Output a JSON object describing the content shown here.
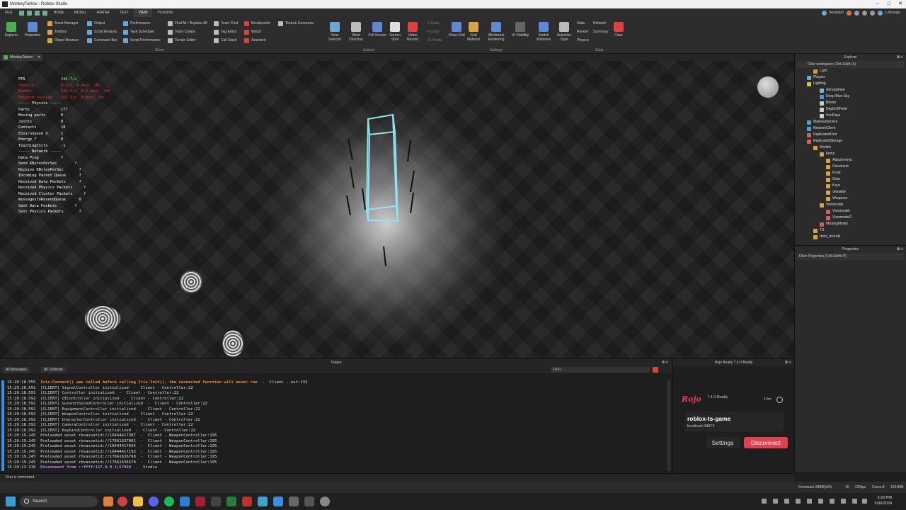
{
  "window": {
    "title": "MonkeyTarkov - Roblox Studio"
  },
  "menu": {
    "tabs": [
      "FILE",
      "HOME",
      "MODEL",
      "AVATAR",
      "TEST",
      "VIEW",
      "PLUGINS"
    ],
    "active": "VIEW",
    "assistant": "Assistant",
    "user": "LeBoogle"
  },
  "ribbon": {
    "show": {
      "label": "Show",
      "big": [
        "Explorer",
        "Properties"
      ],
      "col1": [
        "Asset Manager",
        "Toolbox",
        "Object Browser"
      ],
      "col2": [
        "Output",
        "Script Analysis",
        "Command Bar"
      ],
      "col3": [
        "Performance",
        "Task Scheduler",
        "Script Performance"
      ],
      "col4": [
        "Find All / Replace All",
        "Team Create",
        "Terrain Editor"
      ],
      "col5": [
        "Team Chat",
        "Tag Editor",
        "Call Stack"
      ],
      "col6": [
        "Breakpoints",
        "Watch",
        "Assistant"
      ],
      "col7": [
        "Texture Generator"
      ]
    },
    "actions": {
      "label": "Actions",
      "buttons": [
        "View Selector",
        "Wind Direction",
        "Full Screen",
        "Screen Shot",
        "Video Record"
      ]
    },
    "settings": {
      "label": "Settings",
      "studs": [
        "2 Studs",
        "4 Studs",
        "16 Studs"
      ],
      "buttons": [
        "Show Grid",
        "Grid Material",
        "Wireframe Rendering",
        "UI Visibility",
        "Switch Windows",
        "Selection Style"
      ]
    },
    "stats": {
      "label": "Stats",
      "col1": [
        "Stats",
        "Render",
        "Physics"
      ],
      "col2": [
        "Network",
        "Summary"
      ],
      "clear": "Clear"
    }
  },
  "document_tab": "MonkeyTarkov",
  "viewport_stats": [
    {
      "k": "FPS",
      "v": "246.7/s",
      "c": "grn"
    },
    {
      "k": "Physics",
      "v": "0.0/s  0 msec  0%",
      "c": "red"
    },
    {
      "k": "Render",
      "v": "243.3/s  0.5 msec  12%",
      "c": "red"
    },
    {
      "k": "Network receive",
      "v": "163.1/s  0 msec  0%",
      "c": "red"
    },
    {
      "k": "----- Physics -----",
      "v": "",
      "c": ""
    },
    {
      "k": "Parts",
      "v": "177",
      "c": ""
    },
    {
      "k": "Moving parts",
      "v": "0",
      "c": ""
    },
    {
      "k": "Joints",
      "v": "0",
      "c": ""
    },
    {
      "k": "Contacts",
      "v": "10",
      "c": ""
    },
    {
      "k": "EnviroSpeed X",
      "v": "1",
      "c": ""
    },
    {
      "k": "Energy T",
      "v": "0",
      "c": ""
    },
    {
      "k": "TouchingCtcts",
      "v": "-1",
      "c": ""
    },
    {
      "k": "----- Network -----",
      "v": "",
      "c": ""
    },
    {
      "k": "Data Ping",
      "v": "?",
      "c": ""
    },
    {
      "k": "Send KBytesPerSec",
      "v": "      ?",
      "c": ""
    },
    {
      "k": "Receive KBytesPerSec",
      "v": "        ?",
      "c": ""
    },
    {
      "k": "Incoming Packet Queue",
      "v": "        ?",
      "c": ""
    },
    {
      "k": "Received Data Packets",
      "v": "        ?",
      "c": ""
    },
    {
      "k": "Received Physics Packets",
      "v": "          ?",
      "c": ""
    },
    {
      "k": "Received Cluster Packets",
      "v": "          ?",
      "c": ""
    },
    {
      "k": "messagesInResendQueue",
      "v": "        0",
      "c": ""
    },
    {
      "k": "Sent Data Packets",
      "v": "      ?",
      "c": ""
    },
    {
      "k": "Sent Physics Packets",
      "v": "        ?",
      "c": ""
    }
  ],
  "explorer": {
    "title": "Explorer",
    "filter": "Filter workspace (Ctrl+Shift+X)",
    "items": [
      {
        "label": "Light",
        "indent": 2,
        "color": "#c9a227"
      },
      {
        "label": "Players",
        "indent": 1,
        "color": "#6aa6d6"
      },
      {
        "label": "Lighting",
        "indent": 1,
        "color": "#e0c030"
      },
      {
        "label": "Atmosphere",
        "indent": 3,
        "color": "#7ab3e0"
      },
      {
        "label": "Deep Blue Sky",
        "indent": 3,
        "color": "#5c8ad8"
      },
      {
        "label": "Bloom",
        "indent": 3,
        "color": "#cccccc"
      },
      {
        "label": "DepthOfField",
        "indent": 3,
        "color": "#cccccc"
      },
      {
        "label": "SunRays",
        "indent": 3,
        "color": "#cccccc"
      },
      {
        "label": "MaterialService",
        "indent": 1,
        "color": "#4da3c9"
      },
      {
        "label": "NetworkClient",
        "indent": 1,
        "color": "#4da3c9"
      },
      {
        "label": "ReplicatedFirst",
        "indent": 1,
        "color": "#d06060"
      },
      {
        "label": "ReplicatedStorage",
        "indent": 1,
        "color": "#d06060"
      },
      {
        "label": "Models",
        "indent": 2,
        "color": "#d8a441"
      },
      {
        "label": "Items",
        "indent": 3,
        "color": "#d8a441"
      },
      {
        "label": "Attachments",
        "indent": 4,
        "color": "#d8a441"
      },
      {
        "label": "Document",
        "indent": 4,
        "color": "#d8a441"
      },
      {
        "label": "Food",
        "indent": 4,
        "color": "#d8a441"
      },
      {
        "label": "Gear",
        "indent": 4,
        "color": "#d8a441"
      },
      {
        "label": "Keys",
        "indent": 4,
        "color": "#d8a441"
      },
      {
        "label": "Valuable",
        "indent": 4,
        "color": "#d8a441"
      },
      {
        "label": "Weapons",
        "indent": 4,
        "color": "#d8a441"
      },
      {
        "label": "Viewmodel",
        "indent": 3,
        "color": "#d8a441"
      },
      {
        "label": "Viewmodel",
        "indent": 4,
        "color": "#d06060"
      },
      {
        "label": "Viewmodel2",
        "indent": 4,
        "color": "#d06060"
      },
      {
        "label": "MissingModel",
        "indent": 3,
        "color": "#d06060"
      },
      {
        "label": "TS",
        "indent": 2,
        "color": "#d8a441"
      },
      {
        "label": "rbxts_include",
        "indent": 2,
        "color": "#d8a441"
      }
    ]
  },
  "properties": {
    "title": "Properties",
    "filter": "Filter Properties (Ctrl+Shift+P)"
  },
  "output": {
    "title": "Output",
    "messages_filter": "All Messages",
    "contexts_filter": "All Contexts",
    "search_placeholder": "Filter...",
    "lines": [
      {
        "t": "15:20:18.555",
        "msg": "Iris:Connect() was called before calling Iris.Init(), the connected function will never run",
        "src": "  -  Client - out:133",
        "c": "warn"
      },
      {
        "t": "15:20:18.591",
        "msg": "[CLIENT] SignalController initialized",
        "src": "  -  Client - Controller:22",
        "c": "blue"
      },
      {
        "t": "15:20:18.591",
        "msg": "[CLIENT] Controller initialized",
        "src": "  -  Client - Controller:22",
        "c": "blue"
      },
      {
        "t": "15:20:18.592",
        "msg": "[CLIENT] UIController initialized",
        "src": "  -  Client - Controller:22",
        "c": "blue"
      },
      {
        "t": "15:20:18.592",
        "msg": "[CLIENT] GunshotSoundController initialized",
        "src": "  -  Client - Controller:22",
        "c": "blue"
      },
      {
        "t": "15:20:18.592",
        "msg": "[CLIENT] EquipmentController initialized",
        "src": "  -  Client - Controller:22",
        "c": "blue"
      },
      {
        "t": "15:20:18.592",
        "msg": "[CLIENT] WeaponController initialized",
        "src": "  -  Client - Controller:22",
        "c": "blue"
      },
      {
        "t": "15:20:18.592",
        "msg": "[CLIENT] CharacterController initialized",
        "src": "  -  Client - Controller:22",
        "c": "blue"
      },
      {
        "t": "15:20:18.592",
        "msg": "[CLIENT] CameraController initialized",
        "src": "  -  Client - Controller:22",
        "c": "blue"
      },
      {
        "t": "15:20:18.592",
        "msg": "[CLIENT] KeybindController initialized",
        "src": "  -  Client - Controller:22",
        "c": "blue"
      },
      {
        "t": "15:20:19.245",
        "msg": "Preloaded asset rbxassetid://16444417307",
        "src": "  -  Client - WeaponController:195",
        "c": "lid"
      },
      {
        "t": "15:20:19.245",
        "msg": "Preloaded asset rbxassetid://17661637001",
        "src": "  -  Client - WeaponController:195",
        "c": "lid"
      },
      {
        "t": "15:20:19.245",
        "msg": "Preloaded asset rbxassetid://16444417034",
        "src": "  -  Client - WeaponController:195",
        "c": "lid"
      },
      {
        "t": "15:20:19.245",
        "msg": "Preloaded asset rbxassetid://16444417193",
        "src": "  -  Client - WeaponController:195",
        "c": "lid"
      },
      {
        "t": "15:20:19.245",
        "msg": "Preloaded asset rbxassetid://17661636768",
        "src": "  -  Client - WeaponController:195",
        "c": "lid"
      },
      {
        "t": "15:20:19.245",
        "msg": "Preloaded asset rbxassetid://17661636570",
        "src": "  -  Client - WeaponController:195",
        "c": "lid"
      },
      {
        "t": "15:20:23.318",
        "msg": "Disconnect from ::ffff:127.0.0.1|57960",
        "src": "  -  Studio",
        "c": "purple"
      }
    ]
  },
  "rojo": {
    "title": "Rojo Boatly 7.4.0-Boatly",
    "logo": "Rojo",
    "version": "7.4.0-Boatly",
    "time": "12m",
    "project": "roblox-ts-game",
    "host": "localhost:34872",
    "settings": "Settings",
    "disconnect": "Disconnect"
  },
  "command_bar": {
    "placeholder": "Run a command"
  },
  "status": {
    "scheduler": "Scheduler:2880f|s0%",
    "n1": "10",
    "fps": "220fps",
    "cores": "Cores:8",
    "mem": "1344MB"
  },
  "taskbar": {
    "search": "Search",
    "time": "3:20 PM",
    "date": "5/30/2024"
  }
}
